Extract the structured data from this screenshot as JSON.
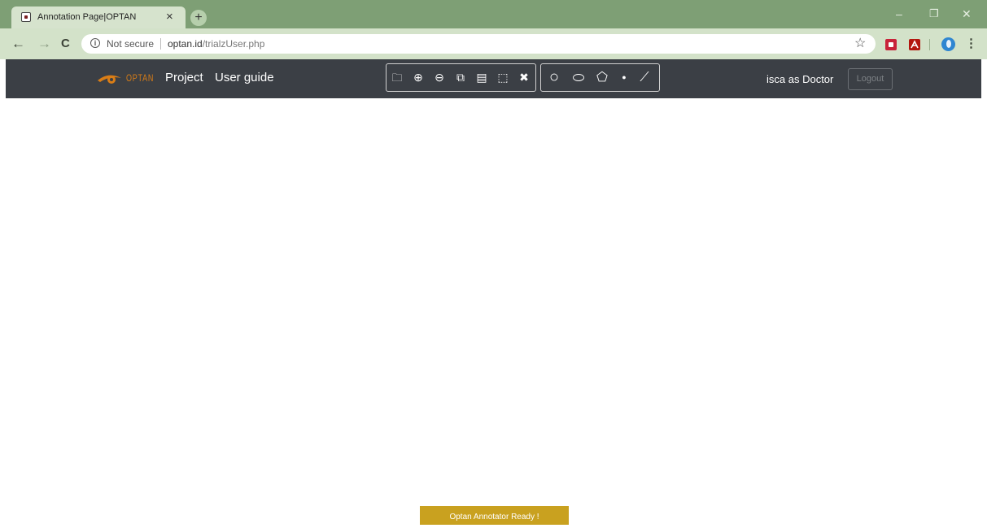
{
  "browser": {
    "tab_title": "Annotation Page|OPTAN",
    "tab_close": "×",
    "new_tab": "+",
    "window_controls": {
      "minimize": "–",
      "restore": "❐",
      "close": "✕"
    },
    "nav": {
      "back": "←",
      "forward": "→",
      "reload": "C"
    },
    "security_label": "Not secure",
    "url_domain": "optan.id",
    "url_path": "/trialzUser.php",
    "bookmark_icon": "☆",
    "menu": "⋮"
  },
  "navbar": {
    "brand": "OPTAN",
    "links": [
      "Project",
      "User guide"
    ],
    "tools_group1": [
      {
        "icon": "open-folder-icon",
        "glyph": "🗀"
      },
      {
        "icon": "zoom-in-icon",
        "glyph": "⊕"
      },
      {
        "icon": "zoom-out-icon",
        "glyph": "⊖"
      },
      {
        "icon": "copy-icon",
        "glyph": "⧉"
      },
      {
        "icon": "paste-icon",
        "glyph": "▤"
      },
      {
        "icon": "select-all-icon",
        "glyph": "⬚"
      },
      {
        "icon": "delete-icon",
        "glyph": "✖"
      }
    ],
    "tools_group2": [
      {
        "icon": "circle-tool-icon",
        "glyph": "○"
      },
      {
        "icon": "ellipse-tool-icon",
        "glyph": "⬭"
      },
      {
        "icon": "polygon-tool-icon",
        "glyph": "⬠"
      },
      {
        "icon": "point-tool-icon",
        "glyph": "●"
      },
      {
        "icon": "polyline-tool-icon",
        "glyph": "⟋"
      }
    ],
    "user": "isca as Doctor",
    "logout": "Logout"
  },
  "toast": "Optan Annotator Ready !",
  "colors": {
    "frame": "#7e9f75",
    "navbar": "#3b3f45",
    "brand": "#d97d16",
    "toast": "#c9a11f"
  }
}
